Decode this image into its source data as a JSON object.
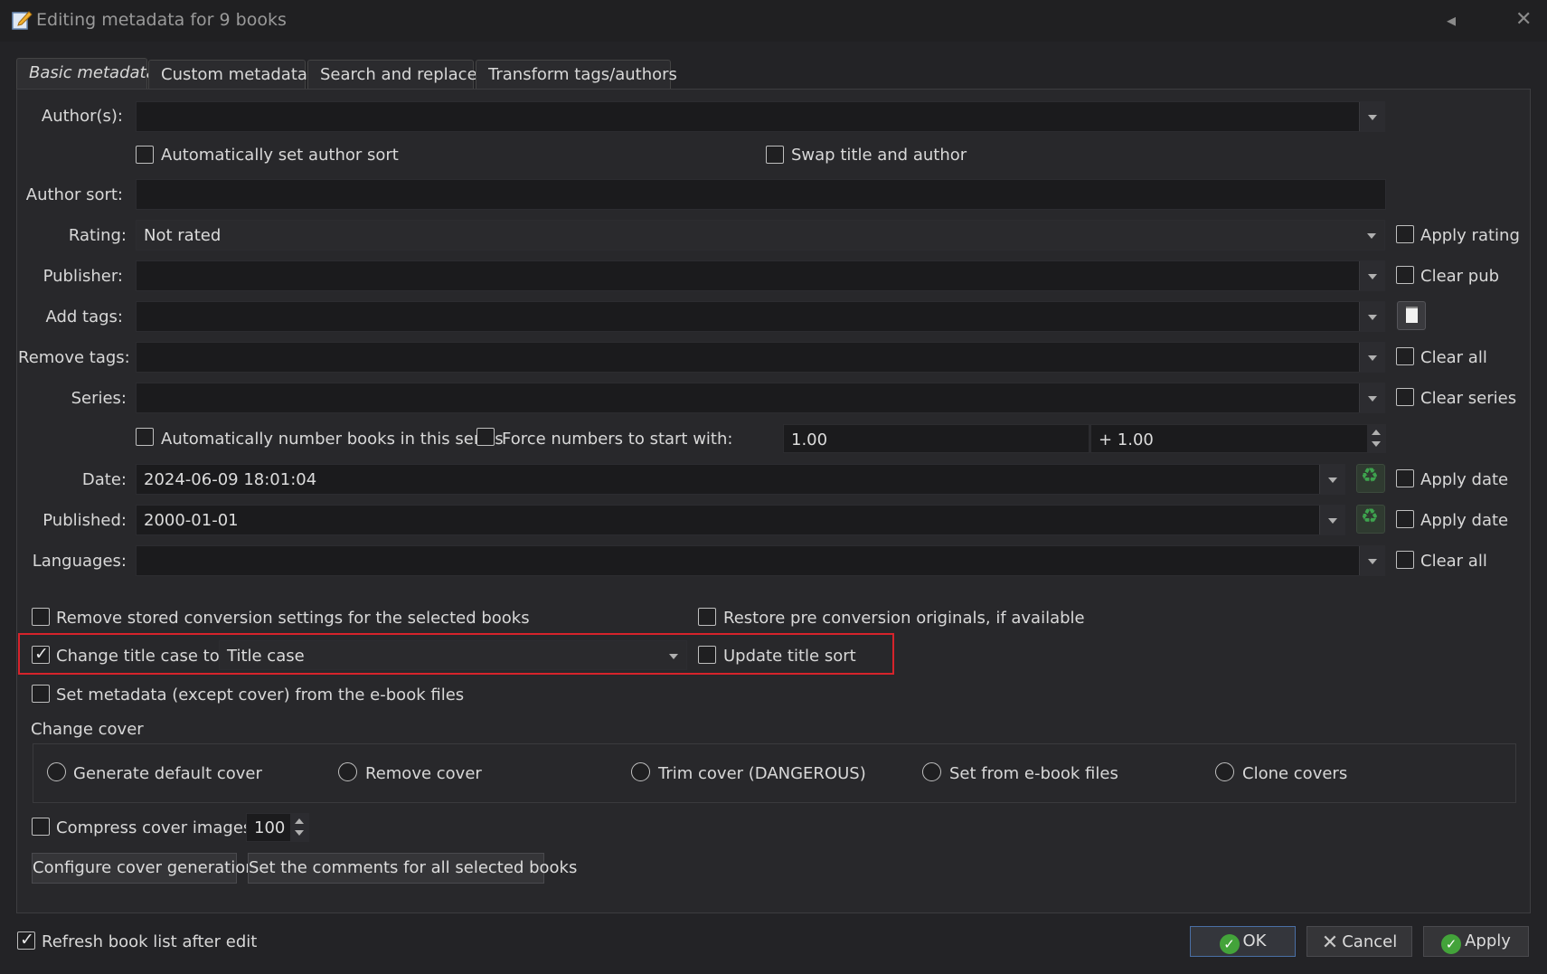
{
  "window": {
    "title": "Editing metadata for 9 books",
    "collapse_glyph": "◂",
    "close_glyph": "✕"
  },
  "tabs": [
    {
      "label": "Basic metadata",
      "active": true
    },
    {
      "label": "Custom metadata",
      "active": false
    },
    {
      "label": "Search and replace",
      "active": false
    },
    {
      "label": "Transform tags/authors",
      "active": false
    }
  ],
  "form": {
    "authors_label": "Author(s):",
    "authors_value": "",
    "auto_author_sort": "Automatically set author sort",
    "swap_title_author": "Swap title and author",
    "author_sort_label": "Author sort:",
    "author_sort_value": "",
    "rating_label": "Rating:",
    "rating_value": "Not rated",
    "apply_rating": "Apply rating",
    "publisher_label": "Publisher:",
    "publisher_value": "",
    "clear_pub": "Clear pub",
    "add_tags_label": "Add tags:",
    "add_tags_value": "",
    "remove_tags_label": "Remove tags:",
    "remove_tags_value": "",
    "clear_all_tags": "Clear all",
    "series_label": "Series:",
    "series_value": "",
    "clear_series": "Clear series",
    "auto_number": "Automatically number books in this series",
    "force_numbers": "Force numbers to start with:",
    "series_start": "1.00",
    "series_increment": "+ 1.00",
    "date_label": "Date:",
    "date_value": "2024-06-09 18:01:04",
    "apply_date": "Apply date",
    "published_label": "Published:",
    "published_value": "2000-01-01",
    "apply_pubdate": "Apply date",
    "languages_label": "Languages:",
    "languages_value": "",
    "clear_languages": "Clear all"
  },
  "options": {
    "remove_conversion": "Remove stored conversion settings for the selected books",
    "restore_originals": "Restore pre conversion originals, if available",
    "change_title_case": "Change title case to:",
    "change_title_case_checked": true,
    "title_case_value": "Title case",
    "update_title_sort": "Update title sort",
    "set_metadata_from_files": "Set metadata (except cover) from the e-book files"
  },
  "cover": {
    "heading": "Change cover",
    "radios": [
      "Generate default cover",
      "Remove cover",
      "Trim cover (DANGEROUS)",
      "Set from e-book files",
      "Clone covers"
    ],
    "compress_label": "Compress cover images:",
    "compress_value": "100",
    "configure_button": "Configure cover generation",
    "comments_button": "Set the comments for all selected books"
  },
  "footer": {
    "refresh_label": "Refresh book list after edit",
    "refresh_checked": true,
    "ok": "OK",
    "cancel": "Cancel",
    "apply": "Apply"
  },
  "colors": {
    "highlight": "#d6232b",
    "accent_green": "#43a33a",
    "background": "#232326"
  }
}
